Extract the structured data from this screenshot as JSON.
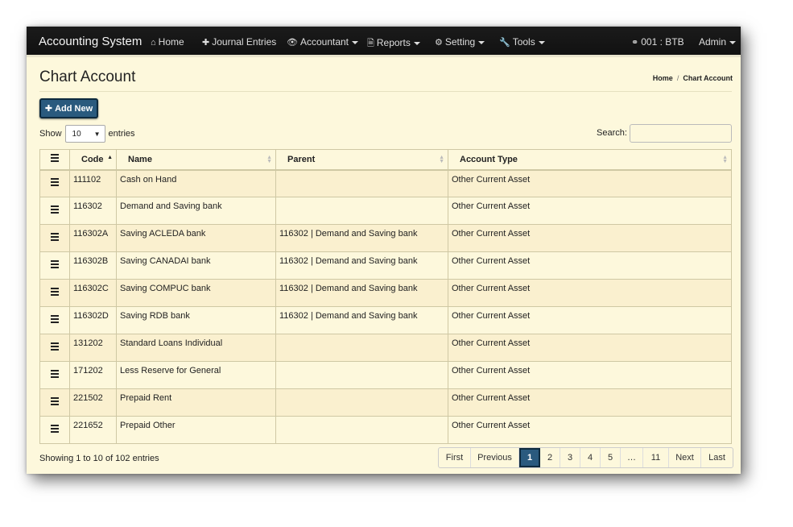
{
  "nav": {
    "brand": "Accounting System",
    "items": [
      {
        "icon": "home-icon",
        "glyph": "⌂",
        "label": "Home",
        "caret": false
      },
      {
        "icon": "plus-icon",
        "glyph": "✚",
        "label": "Journal Entries",
        "caret": false
      },
      {
        "icon": "eye-icon",
        "glyph": "👁",
        "label": "Accountant",
        "caret": true
      },
      {
        "icon": "file-icon",
        "glyph": "🗎",
        "label": "Reports",
        "caret": true
      },
      {
        "icon": "gears-icon",
        "glyph": "⚙",
        "label": "Setting",
        "caret": true
      },
      {
        "icon": "wrench-icon",
        "glyph": "🔧",
        "label": "Tools",
        "caret": true
      }
    ],
    "branch": "001 : BTB",
    "user": "Admin"
  },
  "page": {
    "title": "Chart Account",
    "breadcrumb": [
      "Home",
      "Chart Account"
    ]
  },
  "toolbar": {
    "add_label": "Add New",
    "show_label": "Show",
    "entries_label": "entries",
    "page_size": "10",
    "search_label": "Search:",
    "search_value": ""
  },
  "table": {
    "columns": [
      "Code",
      "Name",
      "Parent",
      "Account Type"
    ],
    "rows": [
      {
        "code": "111102",
        "name": "Cash on Hand",
        "parent": "",
        "type": "Other Current Asset"
      },
      {
        "code": "116302",
        "name": "Demand and Saving bank",
        "parent": "",
        "type": "Other Current Asset"
      },
      {
        "code": "116302A",
        "name": "Saving ACLEDA bank",
        "parent": "116302 | Demand and Saving bank",
        "type": "Other Current Asset"
      },
      {
        "code": "116302B",
        "name": "Saving CANADAI bank",
        "parent": "116302 | Demand and Saving bank",
        "type": "Other Current Asset"
      },
      {
        "code": "116302C",
        "name": "Saving COMPUC bank",
        "parent": "116302 | Demand and Saving bank",
        "type": "Other Current Asset"
      },
      {
        "code": "116302D",
        "name": "Saving RDB bank",
        "parent": "116302 | Demand and Saving bank",
        "type": "Other Current Asset"
      },
      {
        "code": "131202",
        "name": "Standard Loans Individual",
        "parent": "",
        "type": "Other Current Asset"
      },
      {
        "code": "171202",
        "name": "Less Reserve for General",
        "parent": "",
        "type": "Other Current Asset"
      },
      {
        "code": "221502",
        "name": "Prepaid Rent",
        "parent": "",
        "type": "Other Current Asset"
      },
      {
        "code": "221652",
        "name": "Prepaid Other",
        "parent": "",
        "type": "Other Current Asset"
      }
    ]
  },
  "footer": {
    "info": "Showing 1 to 10 of 102 entries",
    "pages": [
      "First",
      "Previous",
      "1",
      "2",
      "3",
      "4",
      "5",
      "…",
      "11",
      "Next",
      "Last"
    ],
    "active_page": "1"
  },
  "colors": {
    "accent": "#2a5a7e",
    "navbar": "#1b1b1b",
    "background": "#fdf8dc"
  }
}
